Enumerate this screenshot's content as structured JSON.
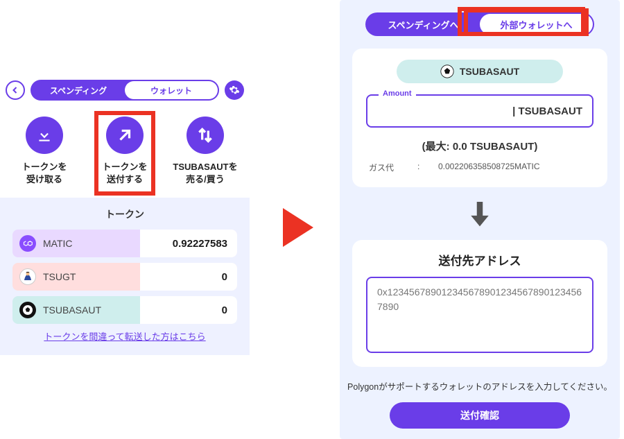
{
  "left": {
    "tab_spending": "スペンディング",
    "tab_wallet": "ウォレット",
    "actions": {
      "receive": "トークンを\n受け取る",
      "send": "トークンを\n送付する",
      "trade": "TSUBASAUTを\n売る/買う"
    },
    "tokens_title": "トークン",
    "tokens": [
      {
        "symbol": "MATIC",
        "balance": "0.92227583",
        "bg": "#e9d9ff",
        "iconBg": "#8a4dff"
      },
      {
        "symbol": "TSUGT",
        "balance": "0",
        "bg": "#ffdede",
        "iconBg": "#ffffff"
      },
      {
        "symbol": "TSUBASAUT",
        "balance": "0",
        "bg": "#cfeeed",
        "iconBg": "#111"
      }
    ],
    "link": "トークンを間違って転送した方はこちら"
  },
  "right": {
    "tab_spending": "スペンディングへ",
    "tab_external": "外部ウォレットへ",
    "token_name": "TSUBASAUT",
    "amount_legend": "Amount",
    "amount_display": "| TSUBASAUT",
    "max_line": "(最大: 0.0 TSUBASAUT)",
    "gas_label": "ガス代",
    "gas_colon": ":",
    "gas_value": "0.002206358508725MATIC",
    "addr_title": "送付先アドレス",
    "addr_value": "0x1234567890123456789012345678901234567890",
    "help": "Polygonがサポートするウォレットのアドレスを入力してください。",
    "confirm": "送付確認"
  }
}
